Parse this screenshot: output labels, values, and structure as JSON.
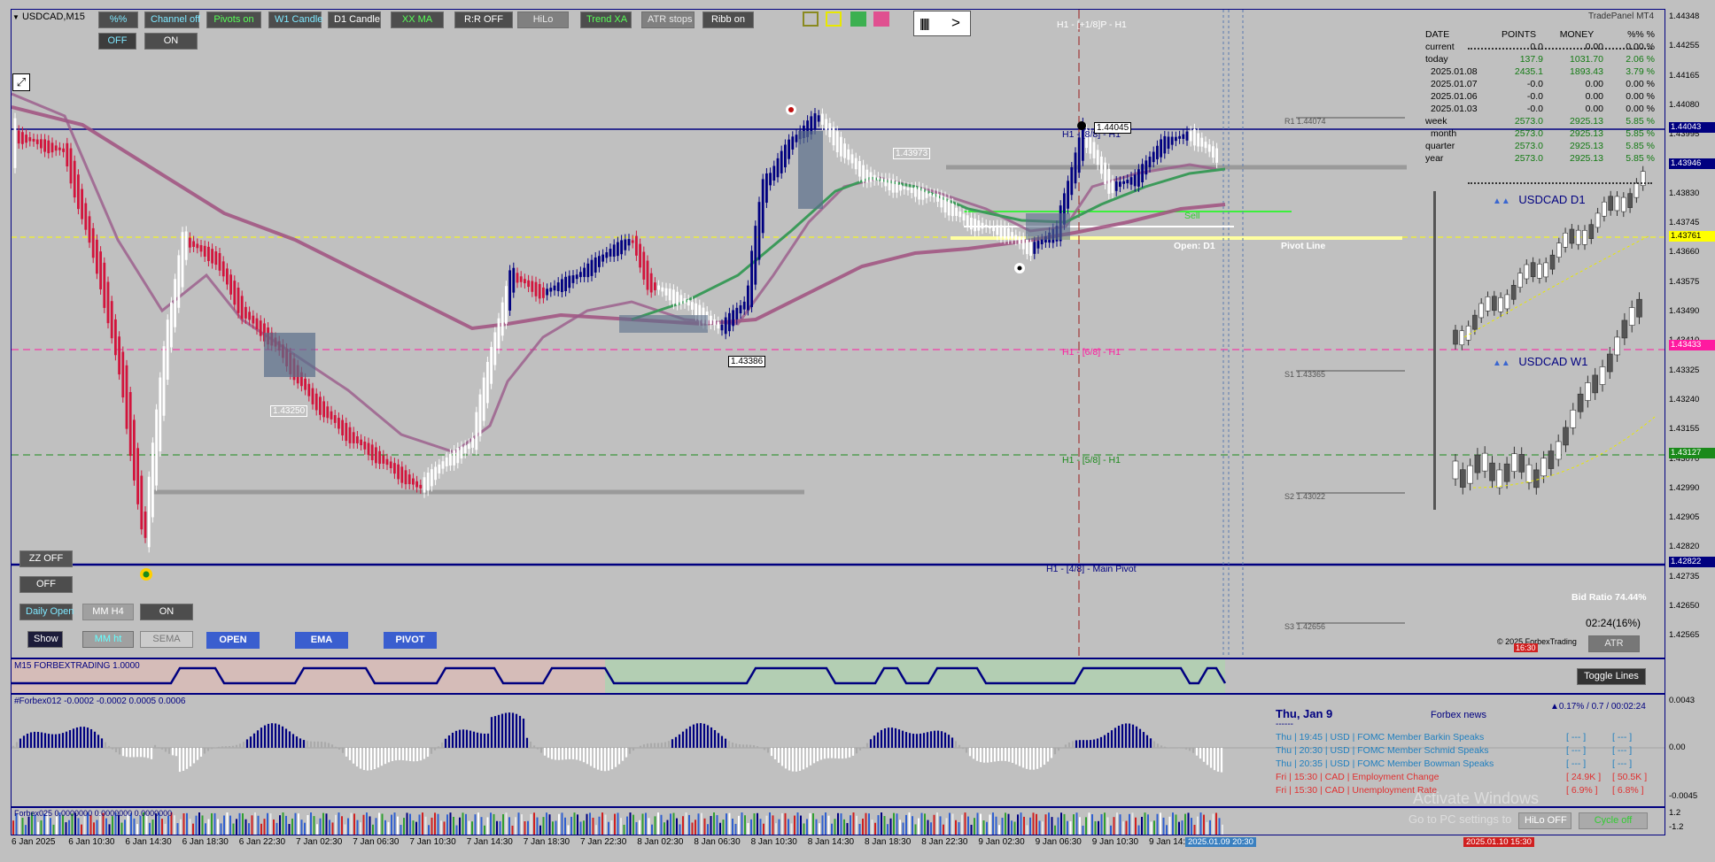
{
  "symbol_title": "USDCAD,M15",
  "platform_label": "TradePanel MT4",
  "colors": {
    "bg": "#c0c0c0",
    "bull": "#000080",
    "bear": "#d2143c",
    "accent_green": "#3c9a5a",
    "ema": "#a0507f",
    "pivot": "#ffff00",
    "magenta_line": "#ff1aa0"
  },
  "toolbar": {
    "buttons": [
      "%%",
      "Channel off",
      "Pivots on",
      "W1 Candle",
      "D1 Candle",
      "XX MA",
      "R:R OFF",
      "HiLo",
      "Trend XA",
      "ATR stops",
      "Ribb on"
    ],
    "sub_buttons": [
      "OFF",
      "ON"
    ],
    "arrow_icon": "chevron-right-icon"
  },
  "left_controls": {
    "zz": "ZZ OFF",
    "zz_state": "OFF",
    "daily_open": "Daily Open",
    "mm_h4": "MM H4",
    "on": "ON",
    "show": "Show",
    "mm_ht": "MM ht",
    "sema": "SEMA",
    "open": "OPEN",
    "ema": "EMA",
    "pivot": "PIVOT"
  },
  "price_axis": [
    "1.44348",
    "1.44255",
    "1.44165",
    "1.44080",
    "1.43995",
    "1.43915",
    "1.43830",
    "1.43745",
    "1.43660",
    "1.43575",
    "1.43490",
    "1.43410",
    "1.43325",
    "1.43240",
    "1.43155",
    "1.43070",
    "1.42990",
    "1.42905",
    "1.42820",
    "1.42735",
    "1.42650",
    "1.42565"
  ],
  "price_tags": {
    "high_line": "1.44043",
    "current": "1.43946",
    "pivot": "1.43761",
    "magenta": "1.43433",
    "green": "1.43127",
    "low_line": "1.42822"
  },
  "levels": {
    "top": "H1 - [+1/8]P - H1",
    "h1_88": "H1 - [8/8] - H1",
    "h1_68": "H1 - [6/8] - H1",
    "h1_58": "H1 - [5/8] - H1",
    "main_pivot": "H1 - [4/8] - Main Pivot",
    "r1": "R1 1.44074",
    "s1": "S1 1.43365",
    "s2": "S2 1.43022",
    "s3": "S3 1.42656",
    "pivot_line": "Pivot Line",
    "open_d1": "Open: D1",
    "sell": "Sell"
  },
  "price_labels": {
    "p1": "1.43973",
    "p2": "1.44045",
    "p3": "1.43386",
    "p4": "1.43250"
  },
  "trade_panel": {
    "headers": [
      "DATE",
      "POINTS",
      "MONEY",
      "%%  %"
    ],
    "rows": [
      {
        "date": "current",
        "points": "0.0",
        "money": "0.00",
        "pct": "0.00  %"
      },
      {
        "date": "today",
        "points": "137.9",
        "money": "1031.70",
        "pct": "2.06  %"
      },
      {
        "date": "2025.01.08",
        "points": "2435.1",
        "money": "1893.43",
        "pct": "3.79  %"
      },
      {
        "date": "2025.01.07",
        "points": "-0.0",
        "money": "0.00",
        "pct": "0.00  %"
      },
      {
        "date": "2025.01.06",
        "points": "-0.0",
        "money": "0.00",
        "pct": "0.00  %"
      },
      {
        "date": "2025.01.03",
        "points": "-0.0",
        "money": "0.00",
        "pct": "0.00  %"
      },
      {
        "date": "week",
        "points": "2573.0",
        "money": "2925.13",
        "pct": "5.85  %"
      },
      {
        "date": "month",
        "points": "2573.0",
        "money": "2925.13",
        "pct": "5.85  %"
      },
      {
        "date": "quarter",
        "points": "2573.0",
        "money": "2925.13",
        "pct": "5.85  %"
      },
      {
        "date": "year",
        "points": "2573.0",
        "money": "2925.13",
        "pct": "5.85  %"
      }
    ]
  },
  "mini_charts": {
    "d1": "USDCAD  D1",
    "w1": "USDCAD  W1"
  },
  "right_info": {
    "bid_ratio": "Bid Ratio 74.44%",
    "timer": "02:24(16%)",
    "copyright": "© 2025 ForbexTrading",
    "atr": "ATR",
    "toggle_lines": "Toggle Lines",
    "time_tag": "16:30"
  },
  "indicators": {
    "ind1": "M15 FORBEXTRADING 1.0000",
    "ind2": "#Forbex012 -0.0002 -0.0002 0.0005 0.0006",
    "ind3": "Forbex025 0.0000000 0.0000000 0.0000000",
    "ind2_axis": [
      "0.0043",
      "0.00",
      "-0.0045"
    ],
    "ind3_axis": [
      "1.2",
      "-1.2"
    ]
  },
  "news": {
    "date": "Thu, Jan 9",
    "source": "Forbex news",
    "dashes": "------",
    "stats": "▲0.17% / 0.7 / 00:02:24",
    "items": [
      {
        "day": "Thu",
        "time": "19:45",
        "cur": "USD",
        "title": "FOMC Member Barkin Speaks",
        "a": "[ --- ]",
        "b": "[ --- ]",
        "color": "#1f7fbf"
      },
      {
        "day": "Thu",
        "time": "20:30",
        "cur": "USD",
        "title": "FOMC Member Schmid Speaks",
        "a": "[ --- ]",
        "b": "[ --- ]",
        "color": "#1f7fbf"
      },
      {
        "day": "Thu",
        "time": "20:35",
        "cur": "USD",
        "title": "FOMC Member Bowman Speaks",
        "a": "[ --- ]",
        "b": "[ --- ]",
        "color": "#1f7fbf"
      },
      {
        "day": "Fri",
        "time": "15:30",
        "cur": "CAD",
        "title": "Employment Change",
        "a": "[ 24.9K ]",
        "b": "[ 50.5K ]",
        "color": "#e03030"
      },
      {
        "day": "Fri",
        "time": "15:30",
        "cur": "CAD",
        "title": "Unemployment Rate",
        "a": "[ 6.9% ]",
        "b": "[ 6.8% ]",
        "color": "#e03030"
      }
    ],
    "hilo": "HiLo OFF",
    "cycle": "Cycle off",
    "watermark1": "Activate Windows",
    "watermark2": "Go to PC settings to"
  },
  "time_axis": [
    "6 Jan 2025",
    "6 Jan 10:30",
    "6 Jan 14:30",
    "6 Jan 18:30",
    "6 Jan 22:30",
    "7 Jan 02:30",
    "7 Jan 06:30",
    "7 Jan 10:30",
    "7 Jan 14:30",
    "7 Jan 18:30",
    "7 Jan 22:30",
    "8 Jan 02:30",
    "8 Jan 06:30",
    "8 Jan 10:30",
    "8 Jan 14:30",
    "8 Jan 18:30",
    "8 Jan 22:30",
    "9 Jan 02:30",
    "9 Jan 06:30",
    "9 Jan 10:30",
    "9 Jan 14:30"
  ],
  "time_tag_cursor": "2025.01.09 20:30",
  "time_tag_next": "2025.01.10 15:30"
}
